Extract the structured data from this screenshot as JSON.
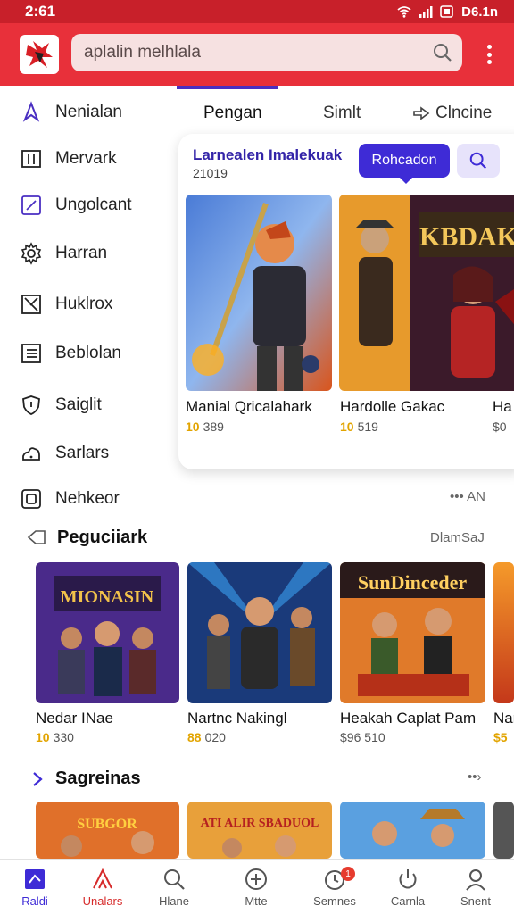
{
  "status": {
    "time": "2:61",
    "clock": "D6.1n"
  },
  "search": {
    "value": "aplalin melhlala"
  },
  "sidebar": {
    "items": [
      {
        "label": "Nenialan",
        "icon": "compass-icon"
      },
      {
        "label": "Mervark",
        "icon": "columns-icon"
      },
      {
        "label": "Ungolcant",
        "icon": "pen-square-icon"
      },
      {
        "label": "Harran",
        "icon": "gear-icon"
      },
      {
        "label": "Huklrox",
        "icon": "cross-box-icon"
      },
      {
        "label": "Beblolan",
        "icon": "list-icon"
      },
      {
        "label": "Saiglit",
        "icon": "shield-icon"
      },
      {
        "label": "Sarlars",
        "icon": "cloud-icon"
      },
      {
        "label": "Nehkeor",
        "icon": "square-icon"
      }
    ]
  },
  "tabs": {
    "items": [
      "Pengan",
      "Simlt",
      "Clncine"
    ]
  },
  "featured": {
    "title": "Larnealen Imalekuak",
    "subtitle": "21019",
    "button_label": "Rohcadon",
    "games": [
      {
        "title": "Manial Qricalahark",
        "rating": "10",
        "count": "389"
      },
      {
        "title": "Hardolle Gakac",
        "rating": "10",
        "count": "519"
      },
      {
        "title": "Ha",
        "rating": "",
        "count": "$0"
      }
    ],
    "art_text": "KBDAK"
  },
  "more_link": "••• AN",
  "section1": {
    "title": "Peguciiark",
    "link": "DlamSaJ",
    "games": [
      {
        "title": "Nedar INae",
        "rating": "10",
        "count": "330",
        "art_text": "MIONASIN"
      },
      {
        "title": "Nartnc Nakingl",
        "rating": "88",
        "count": "020",
        "art_text": ""
      },
      {
        "title": "Heakah Caplat Pam",
        "rating": "",
        "count": "$96 510",
        "art_text": "SunDinceder"
      },
      {
        "title": "Nar",
        "rating": "$5",
        "count": "",
        "art_text": ""
      }
    ]
  },
  "section2": {
    "title": "Sagreinas",
    "link": "••›",
    "art_texts": [
      "SUBGOR",
      "ATI ALIR SBADUOL"
    ]
  },
  "bottom_nav": {
    "items": [
      {
        "label": "Raldi",
        "icon": "home-icon"
      },
      {
        "label": "Unalars",
        "icon": "tent-icon"
      },
      {
        "label": "Hlane",
        "icon": "search-icon"
      },
      {
        "label": "Mtte",
        "icon": "plus-circle-icon"
      },
      {
        "label": "Semnes",
        "icon": "clock-icon",
        "badge": "1"
      },
      {
        "label": "Carnla",
        "icon": "power-icon"
      },
      {
        "label": "Snent",
        "icon": "person-icon"
      }
    ]
  },
  "colors": {
    "brand": "#e8303a",
    "accent": "#3e2bd6",
    "rating": "#e2a400"
  }
}
